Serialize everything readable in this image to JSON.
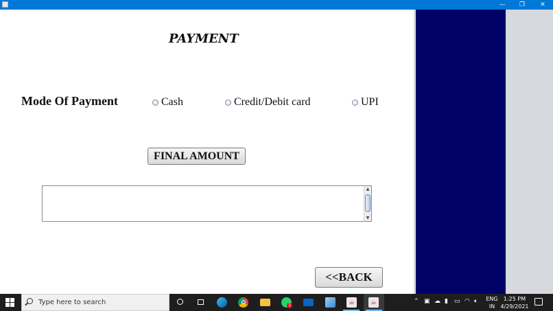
{
  "window": {
    "controls": {
      "minimize": "—",
      "maximize": "❐",
      "close": "✕"
    }
  },
  "form": {
    "title": "PAYMENT",
    "mode_label": "Mode Of Payment",
    "payment_options": [
      "Cash",
      "Credit/Debit card",
      "UPI"
    ],
    "selected_option": null,
    "final_amount_button": "FINAL AMOUNT",
    "output_value": "",
    "back_button": "<<BACK"
  },
  "colors": {
    "titlebar": "#0078d7",
    "side_panel_navy": "#000066",
    "side_panel_gray": "#d6d9de",
    "taskbar": "#1e1e1e"
  },
  "taskbar": {
    "search_placeholder": "Type here to search",
    "pinned": [
      {
        "icon": "cortana-circle-icon"
      },
      {
        "icon": "task-view-icon"
      },
      {
        "icon": "edge-icon"
      },
      {
        "icon": "chrome-icon"
      },
      {
        "icon": "file-explorer-icon"
      },
      {
        "icon": "whatsapp-icon",
        "badge": "1"
      },
      {
        "icon": "mail-icon"
      },
      {
        "icon": "3d-box-icon"
      },
      {
        "icon": "java-icon"
      },
      {
        "icon": "java-icon-active"
      }
    ],
    "tray": {
      "language": "ENG",
      "region": "IN",
      "time": "1:25 PM",
      "date": "4/29/2021"
    }
  }
}
